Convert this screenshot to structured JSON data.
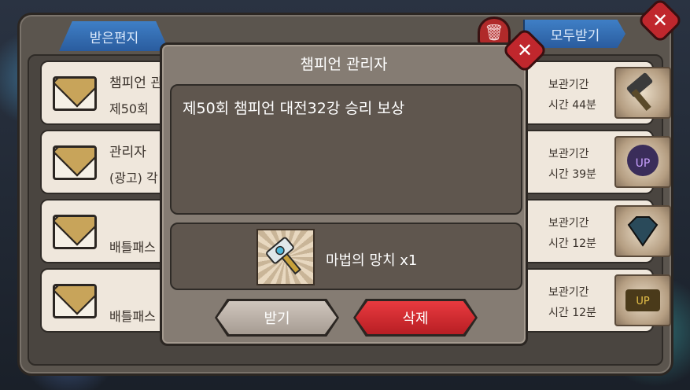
{
  "mailbox": {
    "tab_label": "받은편지",
    "receive_all_label": "모두받기",
    "trash_icon": "trash-icon",
    "close_icon": "close-icon",
    "rows": [
      {
        "title": "챔피언 관",
        "subtitle": "제50회 ",
        "exp_label": "보관기간",
        "exp_time": "시간 44분",
        "item_icon": "hammer-icon"
      },
      {
        "title": "관리자",
        "subtitle": "(광고) 각",
        "exp_label": "보관기간",
        "exp_time": "시간 39분",
        "item_icon": "level-up-icon"
      },
      {
        "title": "",
        "subtitle": "배틀패스",
        "exp_label": "보관기간",
        "exp_time": "시간 12분",
        "item_icon": "diamond-icon"
      },
      {
        "title": "",
        "subtitle": "배틀패스",
        "exp_label": "보관기간",
        "exp_time": "시간 12분",
        "item_icon": "level-up-icon"
      }
    ]
  },
  "dialog": {
    "title": "챔피언 관리자",
    "message": "제50회 챔피언 대전32강 승리 보상",
    "reward_label": "마법의 망치 x1",
    "receive_button": "받기",
    "delete_button": "삭제"
  }
}
